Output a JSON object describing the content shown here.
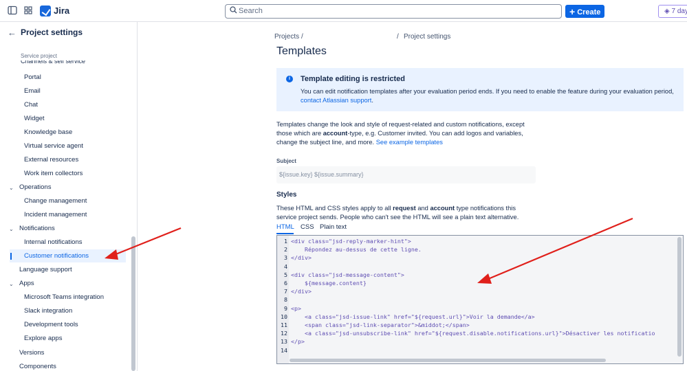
{
  "topbar": {
    "app_name": "Jira",
    "search_placeholder": "Search",
    "create_label": "Create",
    "trial_label": "7 day"
  },
  "sidebar": {
    "title": "Project settings",
    "section_label": "Service project",
    "cut_label": "Channels & self service",
    "items": [
      {
        "label": "Portal"
      },
      {
        "label": "Email"
      },
      {
        "label": "Chat"
      },
      {
        "label": "Widget"
      },
      {
        "label": "Knowledge base"
      },
      {
        "label": "Virtual service agent"
      },
      {
        "label": "External resources"
      },
      {
        "label": "Work item collectors"
      },
      {
        "label": "Operations"
      },
      {
        "label": "Change management"
      },
      {
        "label": "Incident management"
      },
      {
        "label": "Notifications"
      },
      {
        "label": "Internal notifications"
      },
      {
        "label": "Customer notifications"
      },
      {
        "label": "Language support"
      },
      {
        "label": "Apps"
      },
      {
        "label": "Microsoft Teams integration"
      },
      {
        "label": "Slack integration"
      },
      {
        "label": "Development tools"
      },
      {
        "label": "Explore apps"
      },
      {
        "label": "Versions"
      },
      {
        "label": "Components"
      }
    ]
  },
  "breadcrumb": {
    "projects": "Projects",
    "sep1": "/",
    "sep2": "/",
    "current": "Project settings"
  },
  "main": {
    "title": "Templates",
    "banner": {
      "title": "Template editing is restricted",
      "text": "You can edit notification templates after your evaluation period ends. If you need to enable the feature during your evaluation period,",
      "link": "contact Atlassian support",
      "end": "."
    },
    "intro": {
      "part1": "Templates change the look and style of request-related and custom notifications, except those which are",
      "bold1": "account",
      "part2": "-type, e.g. Customer invited. You can add logos and variables, change the subject line, and more.",
      "link": "See example templates"
    },
    "subject_label": "Subject",
    "subject_value": "${issue.key} ${issue.summary}",
    "styles_heading": "Styles",
    "styles_desc": {
      "part1": "These HTML and CSS styles apply to all",
      "bold1": "request",
      "part2": "and",
      "bold2": "account",
      "part3": "type notifications this service project sends. People who can't see the HTML will see a plain text alternative."
    },
    "tabs": [
      "HTML",
      "CSS",
      "Plain text"
    ],
    "editor": {
      "line_numbers": [
        "1",
        "2",
        "3",
        "4",
        "5",
        "6",
        "7",
        "8",
        "9",
        "10",
        "11",
        "12",
        "13",
        "14"
      ],
      "lines": [
        "<div class=\"jsd-reply-marker-hint\">",
        "    Répondez au-dessus de cette ligne.",
        "</div>",
        "",
        "<div class=\"jsd-message-content\">",
        "    ${message.content}",
        "</div>",
        "",
        "<p>",
        "    <a class=\"jsd-issue-link\" href=\"${request.url}\">Voir la demande</a>",
        "    <span class=\"jsd-link-separator\">&middot;</span>",
        "    <a class=\"jsd-unsubscribe-link\" href=\"${request.disable.notifications.url}\">Désactiver les notificatio",
        "</p>",
        ""
      ]
    }
  },
  "colors": {
    "accent": "#0c66e4",
    "banner_bg": "#e9f2ff",
    "annotation_arrow": "#e0201b"
  }
}
